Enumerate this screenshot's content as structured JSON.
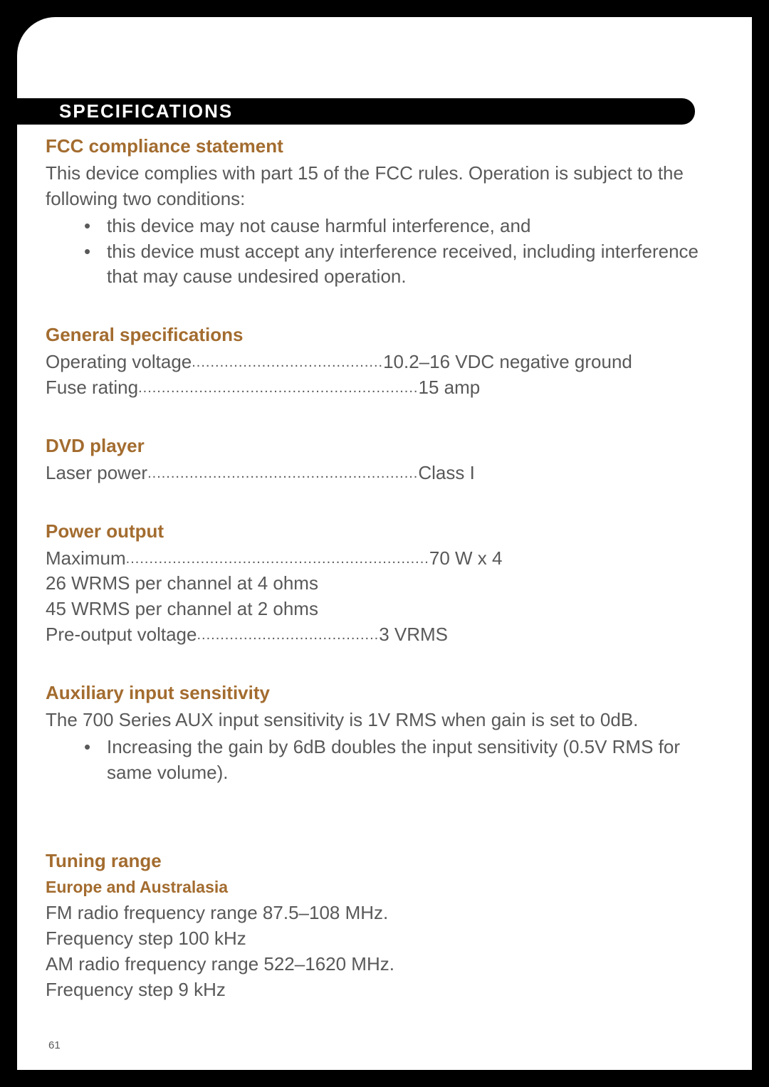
{
  "page": {
    "number": "61",
    "header": "SPECIFICATIONS",
    "sections": {
      "fcc": {
        "title": "FCC compliance statement",
        "intro": "This device complies with part 15 of the FCC rules. Operation is subject to the following two conditions:",
        "bullets": [
          "this device may not cause harmful interference, and",
          "this device must accept any interference received, including interference that may cause undesired operation."
        ]
      },
      "general": {
        "title": "General specifications",
        "rows": [
          {
            "label": "Operating voltage",
            "value": "10.2–16 VDC negative ground"
          },
          {
            "label": "Fuse rating",
            "value": "15 amp"
          }
        ]
      },
      "dvd": {
        "title": "DVD player",
        "rows": [
          {
            "label": "Laser power",
            "value": "Class I"
          }
        ]
      },
      "power": {
        "title": "Power output",
        "rows1": [
          {
            "label": "Maximum",
            "value": "70 W x 4"
          }
        ],
        "free": [
          "26 WRMS per channel at 4 ohms",
          "45 WRMS per channel at 2 ohms"
        ],
        "rows2": [
          {
            "label": "Pre-output voltage",
            "value": "3 VRMS"
          }
        ]
      },
      "aux": {
        "title": "Auxiliary input sensitivity",
        "intro": "The 700 Series AUX input sensitivity is 1V RMS when gain is set to 0dB.",
        "bullets": [
          "Increasing the gain by 6dB doubles the input sensitivity (0.5V RMS for same volume)."
        ]
      },
      "tuning": {
        "title": "Tuning range",
        "region_title": "Europe and Australasia",
        "lines": [
          "FM radio frequency range 87.5–108 MHz.",
          "Frequency step 100 kHz",
          "AM radio frequency range 522–1620 MHz.",
          "Frequency step 9 kHz"
        ]
      }
    }
  }
}
